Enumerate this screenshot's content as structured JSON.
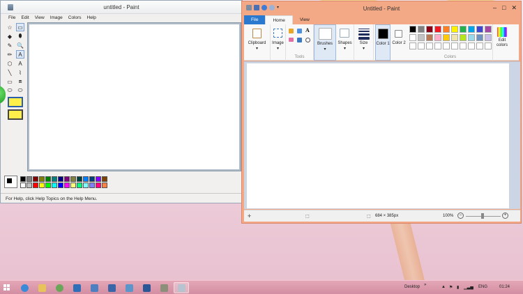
{
  "classic": {
    "title": "untitled - Paint",
    "menu": [
      "File",
      "Edit",
      "View",
      "Image",
      "Colors",
      "Help"
    ],
    "status": "For Help, click Help Topics on the Help Menu.",
    "tools": [
      "☆",
      "▭",
      "◆",
      "⬮",
      "✎",
      "🔍",
      "✏",
      "A",
      "⬡",
      "A",
      "╲",
      "⌇",
      "▭",
      "⧈",
      "⬭",
      "⬭"
    ],
    "palette": [
      "#000000",
      "#808080",
      "#800000",
      "#808000",
      "#008000",
      "#008080",
      "#000080",
      "#800080",
      "#808040",
      "#004040",
      "#0080ff",
      "#004080",
      "#8000ff",
      "#804000",
      "#ffffff",
      "#c0c0c0",
      "#ff0000",
      "#ffff00",
      "#00ff00",
      "#00ffff",
      "#0000ff",
      "#ff00ff",
      "#ffff80",
      "#00ff80",
      "#80ffff",
      "#8080ff",
      "#ff0080",
      "#ff8040"
    ]
  },
  "modern": {
    "title": "Untitled - Paint",
    "tabs": {
      "file": "File",
      "home": "Home",
      "view": "View"
    },
    "groups": {
      "clipboard": "Clipboard",
      "image": "Image",
      "tools": "Tools",
      "brushes": "Brushes",
      "shapes": "Shapes",
      "size": "Size",
      "color1": "Color 1",
      "color2": "Color 2",
      "colors": "Colors",
      "edit_colors": "Edit colors"
    },
    "palette": [
      "#000000",
      "#7f7f7f",
      "#880015",
      "#ed1c24",
      "#ff7f27",
      "#fff200",
      "#22b14c",
      "#00a2e8",
      "#3f48cc",
      "#a349a4",
      "#ffffff",
      "#c3c3c3",
      "#b97a57",
      "#ffaec9",
      "#ffc90e",
      "#efe4b0",
      "#b5e61d",
      "#99d9ea",
      "#7092be",
      "#c8bfe7",
      "#ffffff",
      "#ffffff",
      "#ffffff",
      "#ffffff",
      "#ffffff",
      "#ffffff",
      "#ffffff",
      "#ffffff",
      "#ffffff",
      "#ffffff"
    ],
    "status": {
      "dimensions": "684 × 385px",
      "zoom": "100%"
    }
  },
  "taskbar": {
    "desktop": "Desktop",
    "lang": "ENG",
    "time": "01:24"
  }
}
